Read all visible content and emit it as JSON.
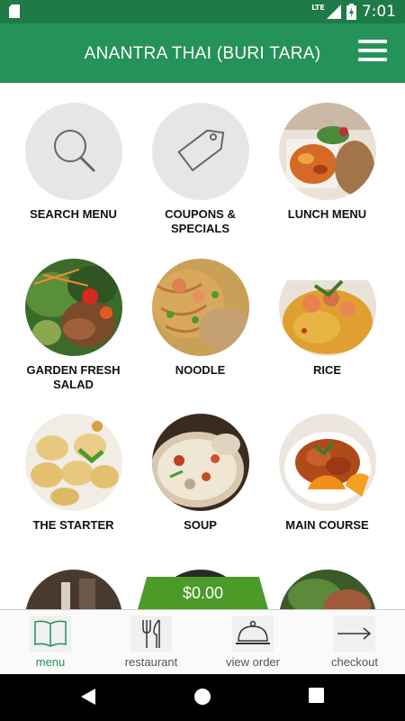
{
  "status_bar": {
    "network": "LTE",
    "time": "7:01"
  },
  "app_bar": {
    "title": "ANANTRA THAI (BURI TARA)",
    "menu_icon": "hamburger-icon"
  },
  "tiles": [
    {
      "label": "SEARCH MENU",
      "icon": "search-icon"
    },
    {
      "label": "COUPONS & SPECIALS",
      "icon": "tag-icon"
    },
    {
      "label": "LUNCH MENU",
      "icon": "lunch-photo"
    },
    {
      "label": "GARDEN FRESH SALAD",
      "icon": "salad-photo"
    },
    {
      "label": "NOODLE",
      "icon": "noodle-photo"
    },
    {
      "label": "RICE",
      "icon": "rice-photo"
    },
    {
      "label": "THE STARTER",
      "icon": "starter-photo"
    },
    {
      "label": "SOUP",
      "icon": "soup-photo"
    },
    {
      "label": "MAIN COURSE",
      "icon": "main-course-photo"
    }
  ],
  "cart": {
    "total": "$0.00"
  },
  "bottom_nav": [
    {
      "label": "menu",
      "icon": "book-icon",
      "active": true
    },
    {
      "label": "restaurant",
      "icon": "fork-knife-icon",
      "active": false
    },
    {
      "label": "view order",
      "icon": "cloche-icon",
      "active": false
    },
    {
      "label": "checkout",
      "icon": "arrow-right-icon",
      "active": false
    }
  ],
  "colors": {
    "primary": "#25925a",
    "status_bar": "#1e7a46",
    "cart": "#4c9a28"
  }
}
